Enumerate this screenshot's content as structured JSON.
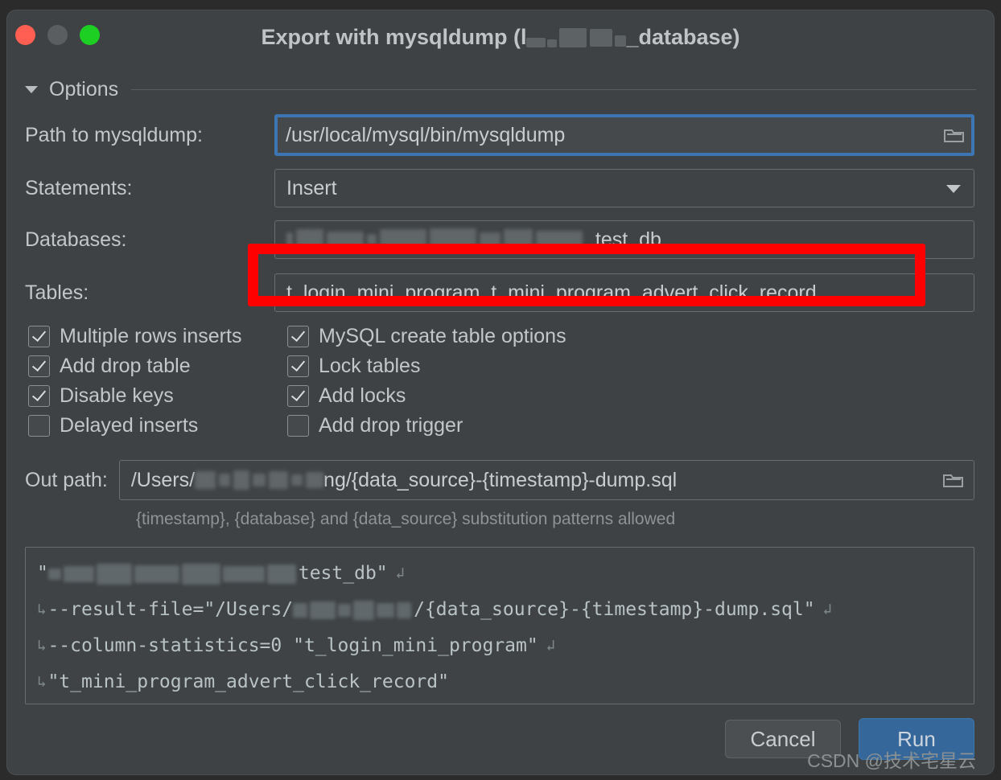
{
  "window": {
    "title_prefix": "Export with mysqldump (l",
    "title_suffix": "_database)",
    "traffic_lights": [
      "close-red",
      "minimize-gray",
      "zoom-green"
    ]
  },
  "options": {
    "section_label": "Options",
    "collapse_icon": "triangle-down-icon"
  },
  "fields": {
    "path_label": "Path to mysqldump:",
    "path_value": "/usr/local/mysql/bin/mysqldump",
    "statements_label": "Statements:",
    "statements_value": "Insert",
    "databases_label": "Databases:",
    "databases_value_visible": "_test_db",
    "tables_label": "Tables:",
    "tables_value": "t_login_mini_program, t_mini_program_advert_click_record"
  },
  "checkboxes": [
    {
      "label": "Multiple rows inserts",
      "checked": true
    },
    {
      "label": "MySQL create table options",
      "checked": true
    },
    {
      "label": "Add drop table",
      "checked": true
    },
    {
      "label": "Lock tables",
      "checked": true
    },
    {
      "label": "Disable keys",
      "checked": true
    },
    {
      "label": "Add locks",
      "checked": true
    },
    {
      "label": "Delayed inserts",
      "checked": false
    },
    {
      "label": "Add drop trigger",
      "checked": false
    }
  ],
  "outpath": {
    "label": "Out path:",
    "value_prefix": "/Users/",
    "value_suffix": "ng/{data_source}-{timestamp}-dump.sql",
    "hint": "{timestamp}, {database} and {data_source} substitution patterns allowed"
  },
  "command_preview": {
    "line1_suffix": "test_db\"",
    "line2": "--result-file=\"/Users/",
    "line2_suffix": "/{data_source}-{timestamp}-dump.sql\"",
    "line3": "--column-statistics=0 \"t_login_mini_program\"",
    "line4": "\"t_mini_program_advert_click_record\"",
    "wrap_glyph": "↲"
  },
  "footer": {
    "cancel_label": "Cancel",
    "run_label": "Run"
  },
  "watermark": "CSDN @技术宅星云",
  "colors": {
    "dialog_bg": "#3e4244",
    "field_bg": "#3f4346",
    "focus_blue": "#3d76b3",
    "run_blue": "#35679a",
    "annotation_red": "#fe0000",
    "text": "#c3c7c9"
  }
}
